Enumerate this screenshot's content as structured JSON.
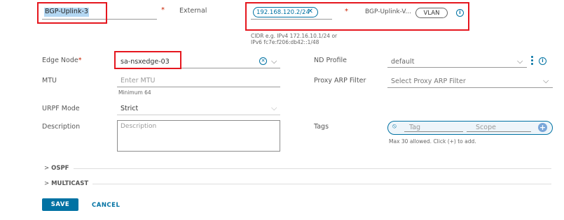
{
  "row1": {
    "name_value": "BGP-Uplink-3",
    "type_value": "External",
    "ip_tag": "192.168.120.2/24",
    "segment_value": "BGP-Uplink-V...",
    "segment_badge": "VLAN",
    "cidr_hint_line1": "CIDR e.g. IPv4 172.16.10.1/24 or",
    "cidr_hint_line2": "IPv6 fc7e:f206:db42::1/48"
  },
  "edge_node": {
    "label": "Edge Node",
    "value": "sa-nsxedge-03"
  },
  "nd_profile": {
    "label": "ND Profile",
    "value": "default"
  },
  "mtu": {
    "label": "MTU",
    "placeholder": "Enter MTU",
    "hint": "Minimum 64"
  },
  "proxy_arp": {
    "label": "Proxy ARP Filter",
    "placeholder": "Select Proxy ARP Filter"
  },
  "urpf": {
    "label": "URPF Mode",
    "value": "Strict"
  },
  "description": {
    "label": "Description",
    "placeholder": "Description"
  },
  "tags": {
    "label": "Tags",
    "tag_placeholder": "Tag",
    "scope_placeholder": "Scope",
    "hint": "Max 30 allowed. Click (+) to add."
  },
  "sections": {
    "ospf": "OSPF",
    "multicast": "MULTICAST"
  },
  "actions": {
    "save": "SAVE",
    "cancel": "CANCEL"
  },
  "colors": {
    "accent": "#0072a3",
    "required": "#c92100",
    "highlight_box": "#e5161e",
    "selection": "#b3d7f2"
  },
  "icons": {
    "remove_tag": "close-icon",
    "info": "info-icon",
    "clear": "clear-circle-icon",
    "dropdown": "chevron-down-icon",
    "more": "vertical-ellipsis-icon",
    "add": "plus-circle-icon",
    "tag": "tag-icon",
    "expand": "chevron-right-icon"
  }
}
